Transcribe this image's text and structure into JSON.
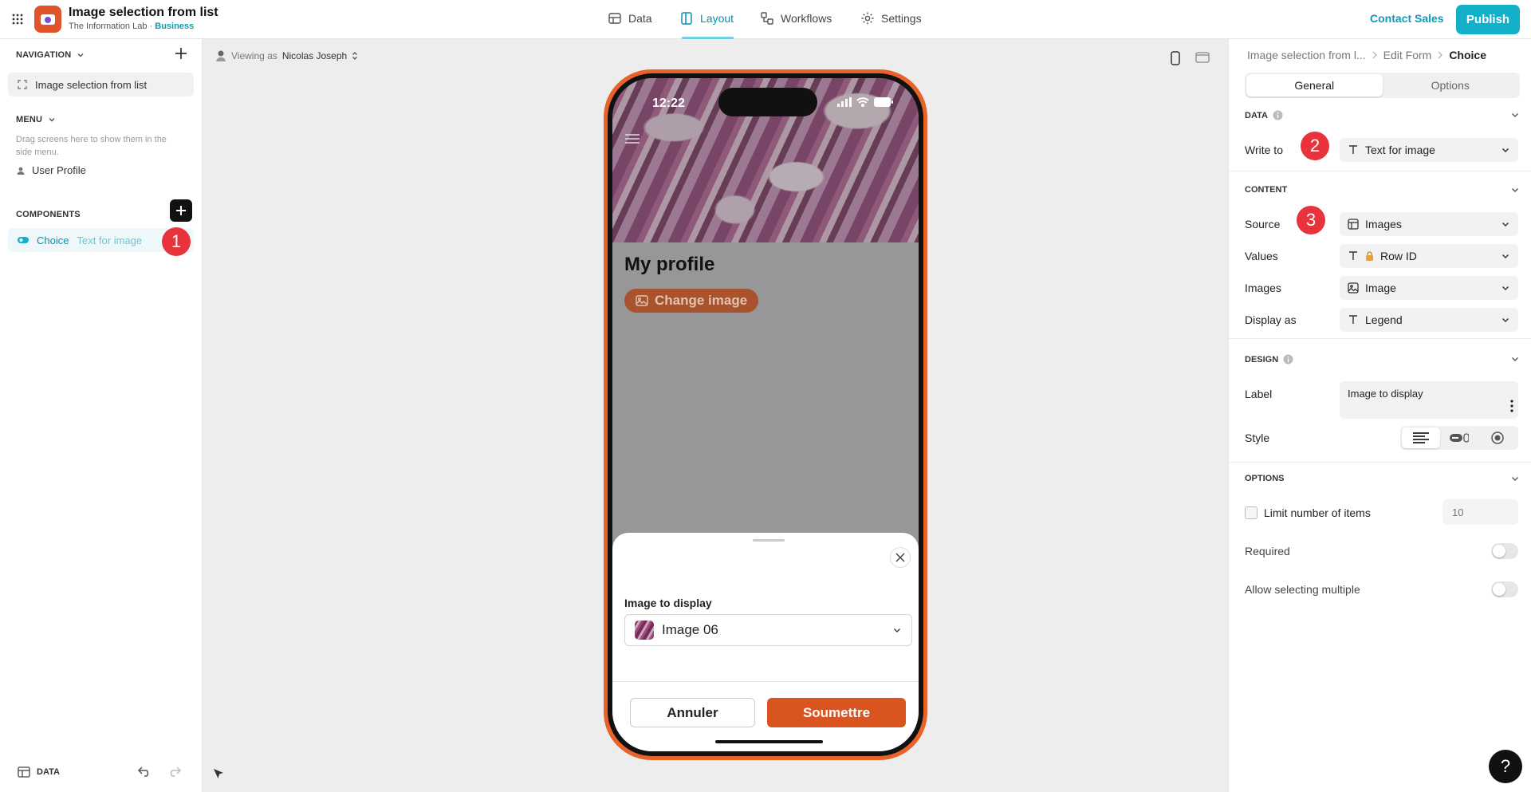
{
  "app": {
    "title": "Image selection from list",
    "org": "The Information Lab",
    "separator": "·",
    "plan": "Business",
    "logo_icon": "camera-app-logo"
  },
  "topnav": [
    {
      "label": "Data",
      "icon": "table-icon",
      "active": false
    },
    {
      "label": "Layout",
      "icon": "layout-icon",
      "active": true
    },
    {
      "label": "Workflows",
      "icon": "workflow-icon",
      "active": false
    },
    {
      "label": "Settings",
      "icon": "gear-icon",
      "active": false
    }
  ],
  "header_actions": {
    "contact_sales": "Contact Sales",
    "publish": "Publish"
  },
  "colors": {
    "accent": "#13b0ca",
    "brand_orange": "#e8622a",
    "badge_red": "#e8323c"
  },
  "sidebar": {
    "navigation_title": "NAVIGATION",
    "navigation_item": "Image selection from list",
    "menu_title": "MENU",
    "menu_hint": "Drag screens here to show them in the side menu.",
    "menu_item": "User Profile",
    "components_title": "COMPONENTS",
    "component": {
      "name": "Choice",
      "sub": "Text for image"
    },
    "bottom_label": "DATA"
  },
  "badges": {
    "b1": "1",
    "b2": "2",
    "b3": "3"
  },
  "canvas": {
    "viewing_prefix": "Viewing as",
    "viewing_user": "Nicolas Joseph"
  },
  "phone": {
    "time": "12:22",
    "profile_title": "My profile",
    "change_image": "Change image",
    "sheet_label": "Image to display",
    "selected_value": "Image 06",
    "cancel": "Annuler",
    "submit": "Soumettre"
  },
  "panel": {
    "breadcrumbs": [
      "Image selection from l...",
      "Edit Form",
      "Choice"
    ],
    "tabs": [
      "General",
      "Options"
    ],
    "data_title": "DATA",
    "write_to_label": "Write to",
    "write_to_value": "Text for image",
    "content_title": "CONTENT",
    "source_label": "Source",
    "source_value": "Images",
    "values_label": "Values",
    "values_value": "Row ID",
    "images_label": "Images",
    "images_value": "Image",
    "display_as_label": "Display as",
    "display_as_value": "Legend",
    "design_title": "DESIGN",
    "label_label": "Label",
    "label_value": "Image to display",
    "style_label": "Style",
    "options_title": "OPTIONS",
    "limit_label": "Limit number of items",
    "limit_placeholder": "10",
    "required_label": "Required",
    "allow_multiple_label": "Allow selecting multiple"
  },
  "help": "?"
}
